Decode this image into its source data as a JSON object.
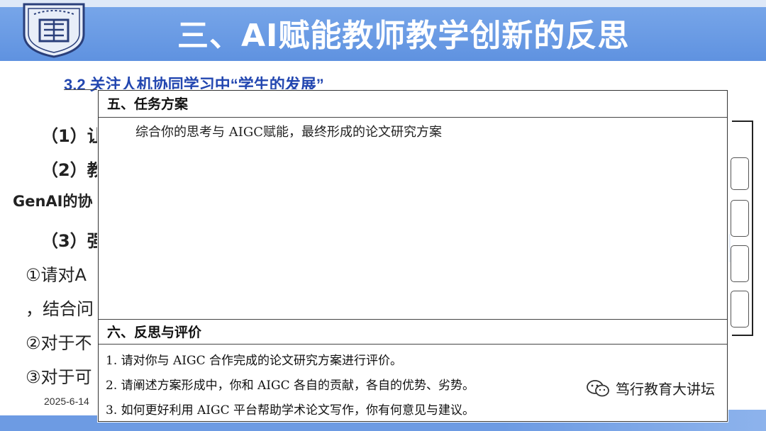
{
  "header": {
    "title": "三、AI赋能教师教学创新的反思",
    "subtitle": "3.2  关注人机协同学习中“学生的发展”",
    "colors": {
      "banner": "#5f92e0",
      "subtitle": "#2347b0"
    }
  },
  "background_text": {
    "item1": "（1）让",
    "item2": "（2）教",
    "item2_cont": "GenAI的协",
    "item3": "（3）强",
    "circ1": "①请对A",
    "circ1_cont": "，结合问",
    "circ2": "②对于不",
    "circ3": "③对于可"
  },
  "footer": {
    "date": "2025-6-14"
  },
  "document": {
    "section5": {
      "heading": "五、任务方案",
      "body": "综合你的思考与 AIGC赋能，最终形成的论文研究方案"
    },
    "section6": {
      "heading": "六、反思与评价",
      "questions": [
        "1. 请对你与 AIGC 合作完成的论文研究方案进行评价。",
        "2. 请阐述方案形成中，你和 AIGC 各自的贡献，各自的优势、劣势。",
        "3. 如何更好利用 AIGC 平台帮助学术论文写作，你有何意见与建议。"
      ]
    }
  },
  "watermark": {
    "icon": "wechat-icon",
    "text": "笃行教育大讲坛"
  }
}
